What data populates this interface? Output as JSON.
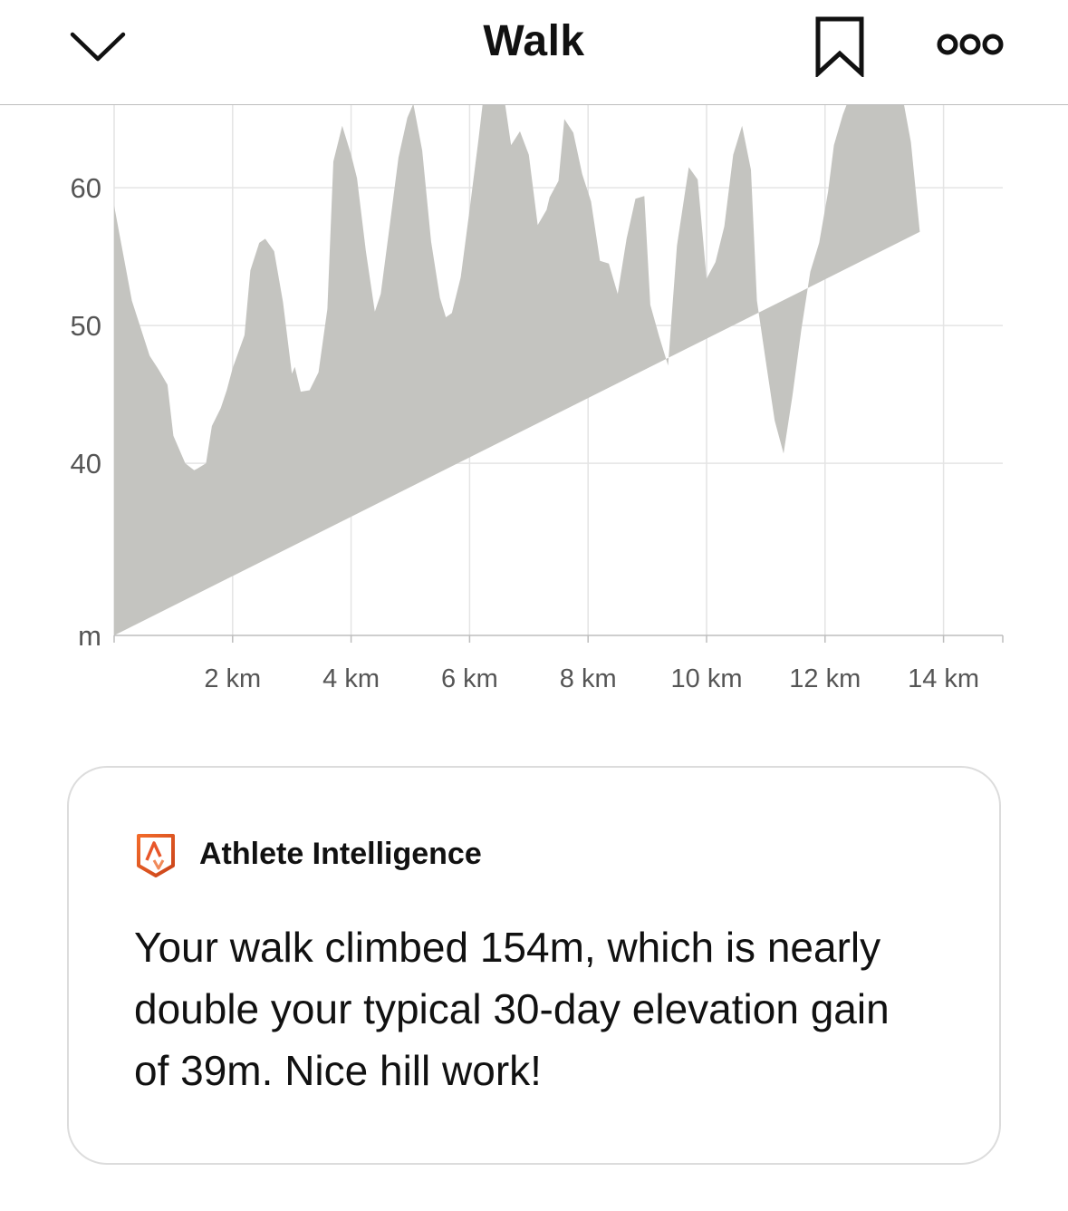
{
  "header": {
    "title": "Walk",
    "back_icon": "chevron-down-icon",
    "bookmark_icon": "bookmark-icon",
    "more_icon": "more-dots-icon"
  },
  "chart_data": {
    "type": "area",
    "title": "",
    "xlabel": "",
    "ylabel": "m",
    "xlim": [
      0,
      15
    ],
    "ylim": [
      27.5,
      66
    ],
    "color": "#c4c4c0",
    "grid": true,
    "y_ticks": [
      {
        "value": 60,
        "label": "60"
      },
      {
        "value": 50,
        "label": "50"
      },
      {
        "value": 40,
        "label": "40"
      }
    ],
    "y_unit_label": "m",
    "x_ticks": [
      {
        "value": 2,
        "label": "2 km"
      },
      {
        "value": 4,
        "label": "4 km"
      },
      {
        "value": 6,
        "label": "6 km"
      },
      {
        "value": 8,
        "label": "8 km"
      },
      {
        "value": 10,
        "label": "10 km"
      },
      {
        "value": 12,
        "label": "12 km"
      },
      {
        "value": 14,
        "label": "14 km"
      }
    ],
    "x": [
      0,
      0.3,
      0.6,
      0.75,
      0.9,
      1.0,
      1.2,
      1.35,
      1.4,
      1.55,
      1.65,
      1.8,
      1.9,
      2.0,
      2.2,
      2.3,
      2.45,
      2.55,
      2.7,
      2.85,
      3.0,
      3.05,
      3.15,
      3.3,
      3.45,
      3.6,
      3.7,
      3.85,
      4.0,
      4.1,
      4.25,
      4.4,
      4.5,
      4.65,
      4.8,
      4.95,
      5.05,
      5.2,
      5.35,
      5.5,
      5.6,
      5.7,
      5.85,
      6.0,
      6.15,
      6.3,
      6.5,
      6.7,
      6.85,
      7.0,
      7.15,
      7.3,
      7.35,
      7.5,
      7.6,
      7.75,
      7.9,
      8.05,
      8.2,
      8.35,
      8.5,
      8.65,
      8.8,
      8.95,
      9.05,
      9.2,
      9.35,
      9.5,
      9.7,
      9.85,
      10.0,
      10.15,
      10.3,
      10.45,
      10.6,
      10.75,
      10.85,
      11.0,
      11.15,
      11.3,
      11.45,
      11.6,
      11.75,
      11.9,
      12.05,
      12.15,
      12.3,
      12.45,
      12.6,
      12.75,
      12.95,
      13.1,
      13.3,
      13.45,
      13.6,
      13.7,
      13.85,
      14.05,
      14.3,
      14.45,
      14.6,
      14.75,
      14.85,
      15.0
    ],
    "y": [
      58.7,
      51.8,
      47.8,
      46.8,
      45.7,
      42.0,
      40.0,
      39.5,
      39.6,
      40.0,
      42.7,
      44.0,
      45.3,
      46.9,
      49.3,
      54.0,
      56.0,
      56.3,
      55.4,
      51.7,
      46.5,
      47.0,
      45.2,
      45.3,
      46.6,
      51.2,
      61.9,
      64.5,
      62.4,
      60.7,
      55.4,
      51.0,
      52.3,
      57.2,
      62.2,
      65.1,
      66.1,
      62.7,
      56.1,
      52.0,
      50.6,
      50.9,
      53.5,
      58.4,
      63.5,
      69.0,
      69.0,
      63.1,
      64.1,
      62.4,
      57.3,
      58.4,
      59.3,
      60.5,
      65.0,
      64.0,
      61.0,
      59.0,
      54.7,
      54.5,
      52.3,
      56.3,
      59.2,
      59.4,
      51.5,
      49.2,
      47.1,
      55.8,
      61.5,
      60.6,
      53.4,
      54.6,
      57.2,
      62.4,
      64.5,
      61.3,
      51.8,
      47.4,
      43.1,
      40.7,
      44.9,
      49.7,
      53.9,
      56.0,
      59.7,
      63.1,
      65.3,
      67.0,
      66.2,
      69.0,
      69.0,
      69.0,
      66.8,
      63.3,
      56.8
    ]
  },
  "card": {
    "logo_icon": "strava-logo-icon",
    "title": "Athlete Intelligence",
    "body": "Your walk climbed 154m, which is nearly double your typical 30-day elevation gain of 39m. Nice hill work!"
  }
}
